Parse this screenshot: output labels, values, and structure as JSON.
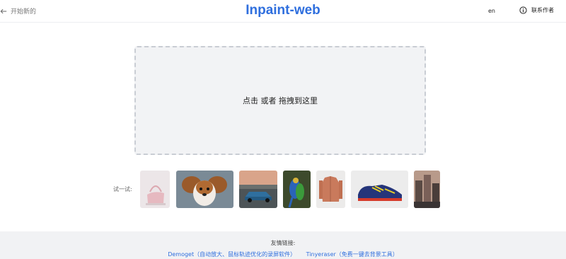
{
  "header": {
    "back_label": "开始新的",
    "title": "Inpaint-web",
    "lang_label": "en",
    "author_label": "联系作者"
  },
  "upload": {
    "prompt": "点击 或者 拖拽到这里"
  },
  "examples": {
    "label": "试一试:",
    "items": [
      {
        "name": "handbag"
      },
      {
        "name": "dog"
      },
      {
        "name": "car"
      },
      {
        "name": "parrot"
      },
      {
        "name": "jacket"
      },
      {
        "name": "sneaker"
      },
      {
        "name": "city"
      }
    ]
  },
  "footer": {
    "title": "友情链接:",
    "links": [
      {
        "label": "Demoget（自动放大、鼠标轨迹优化的录屏软件）"
      },
      {
        "label": "Tinyeraser（免费一键去背景工具）"
      }
    ]
  },
  "colors": {
    "accent": "#2f6fde",
    "dropzone_bg": "#f2f3f5",
    "footer_bg": "#f1f2f4"
  }
}
